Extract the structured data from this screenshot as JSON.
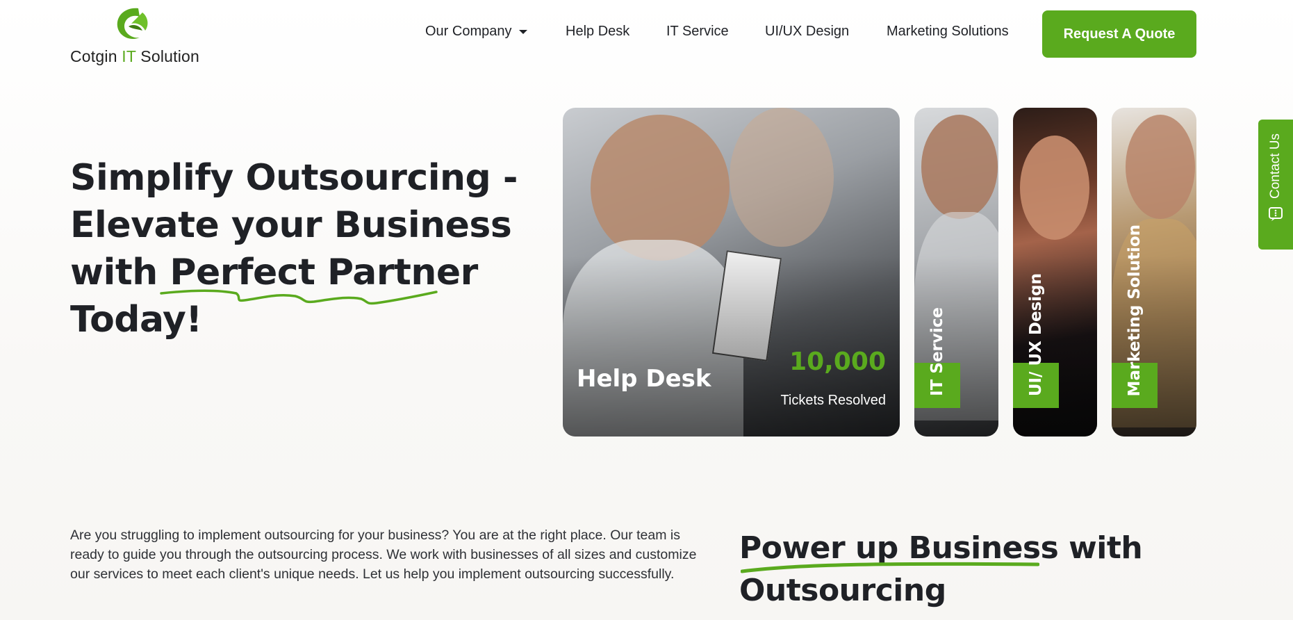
{
  "brand": {
    "name_part1": "Cotgin ",
    "name_accent": "IT",
    "name_part2": " Solution",
    "accent_color": "#5aaa1e"
  },
  "nav": {
    "items": [
      {
        "label": "Our Company",
        "has_dropdown": true
      },
      {
        "label": "Help Desk"
      },
      {
        "label": "IT Service"
      },
      {
        "label": "UI/UX Design"
      },
      {
        "label": "Marketing Solutions"
      }
    ],
    "cta_label": "Request A Quote"
  },
  "hero": {
    "lines": [
      "Simplify Outsourcing -",
      "Elevate your Business",
      "with Perfect Partner",
      "Today!"
    ]
  },
  "cards": {
    "main": {
      "label": "Help Desk",
      "stat_value": "10,000",
      "stat_caption": "Tickets Resolved"
    },
    "it": {
      "label": "IT Service"
    },
    "ui": {
      "label": "UI/ UX Design"
    },
    "marketing": {
      "label": "Marketing Solution"
    }
  },
  "contact_tab": {
    "label": "Contact Us",
    "icon": "chat-icon"
  },
  "intro": {
    "text": "Are you struggling to implement outsourcing for your business? You are at the right place. Our team is ready to guide you through the outsourcing process. We work with businesses of all sizes and customize our services to meet each client's unique needs. Let us help you implement outsourcing successfully."
  },
  "power": {
    "lines": [
      "Power up Business with",
      "Outsourcing"
    ]
  }
}
